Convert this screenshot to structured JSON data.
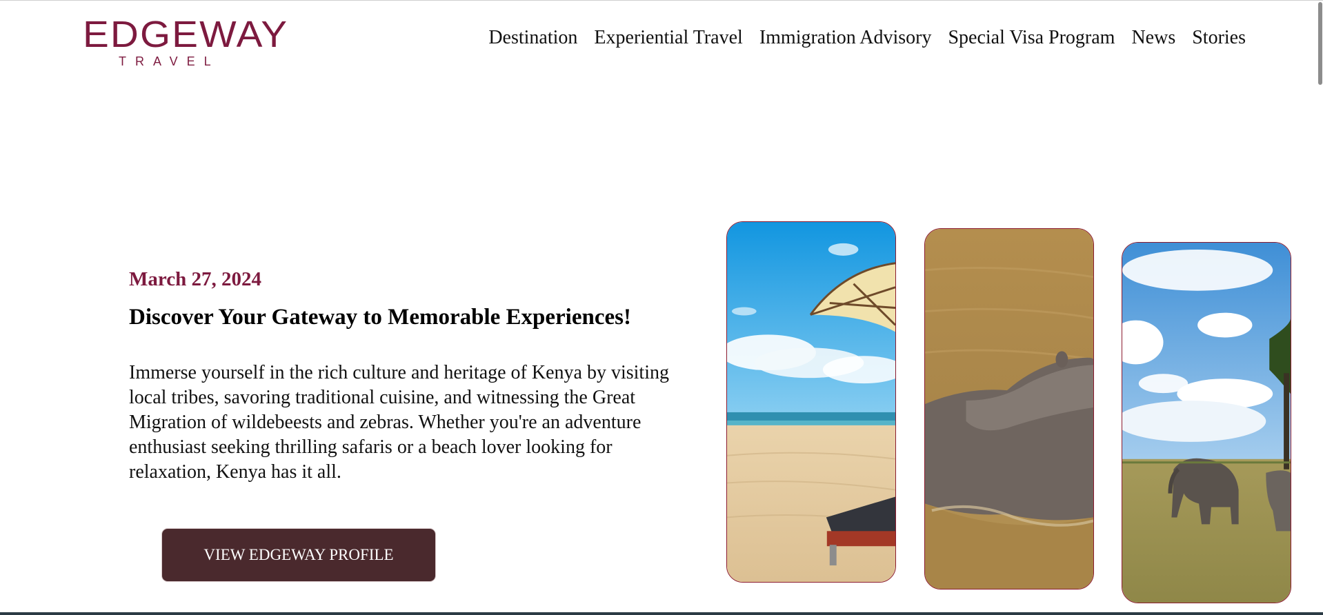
{
  "brand": {
    "name": "EDGEWAY",
    "subtitle": "TRAVEL",
    "color": "#7d1a3f"
  },
  "nav": {
    "items": [
      {
        "label": "Destination"
      },
      {
        "label": "Experiential Travel"
      },
      {
        "label": "Immigration Advisory"
      },
      {
        "label": "Special Visa Program"
      },
      {
        "label": "News"
      },
      {
        "label": "Stories"
      }
    ]
  },
  "hero": {
    "date": "March 27, 2024",
    "title": "Discover Your Gateway to Memorable Experiences!",
    "body": "Immerse yourself in the rich culture and heritage of Kenya by visiting local tribes, savoring traditional cuisine, and witnessing the Great Migration of wildebeests and zebras. Whether you're an adventure enthusiast seeking thrilling safaris or a beach lover looking for relaxation, Kenya has it all.",
    "cta_label": "VIEW EDGEWAY PROFILE",
    "cta_color": "#4a292d",
    "date_color": "#7d1a3f"
  },
  "gallery": {
    "cards": [
      {
        "subject": "beach-umbrella-photo"
      },
      {
        "subject": "hippo-river-photo"
      },
      {
        "subject": "elephants-savanna-photo"
      }
    ],
    "border_color": "#8b1a2e"
  }
}
